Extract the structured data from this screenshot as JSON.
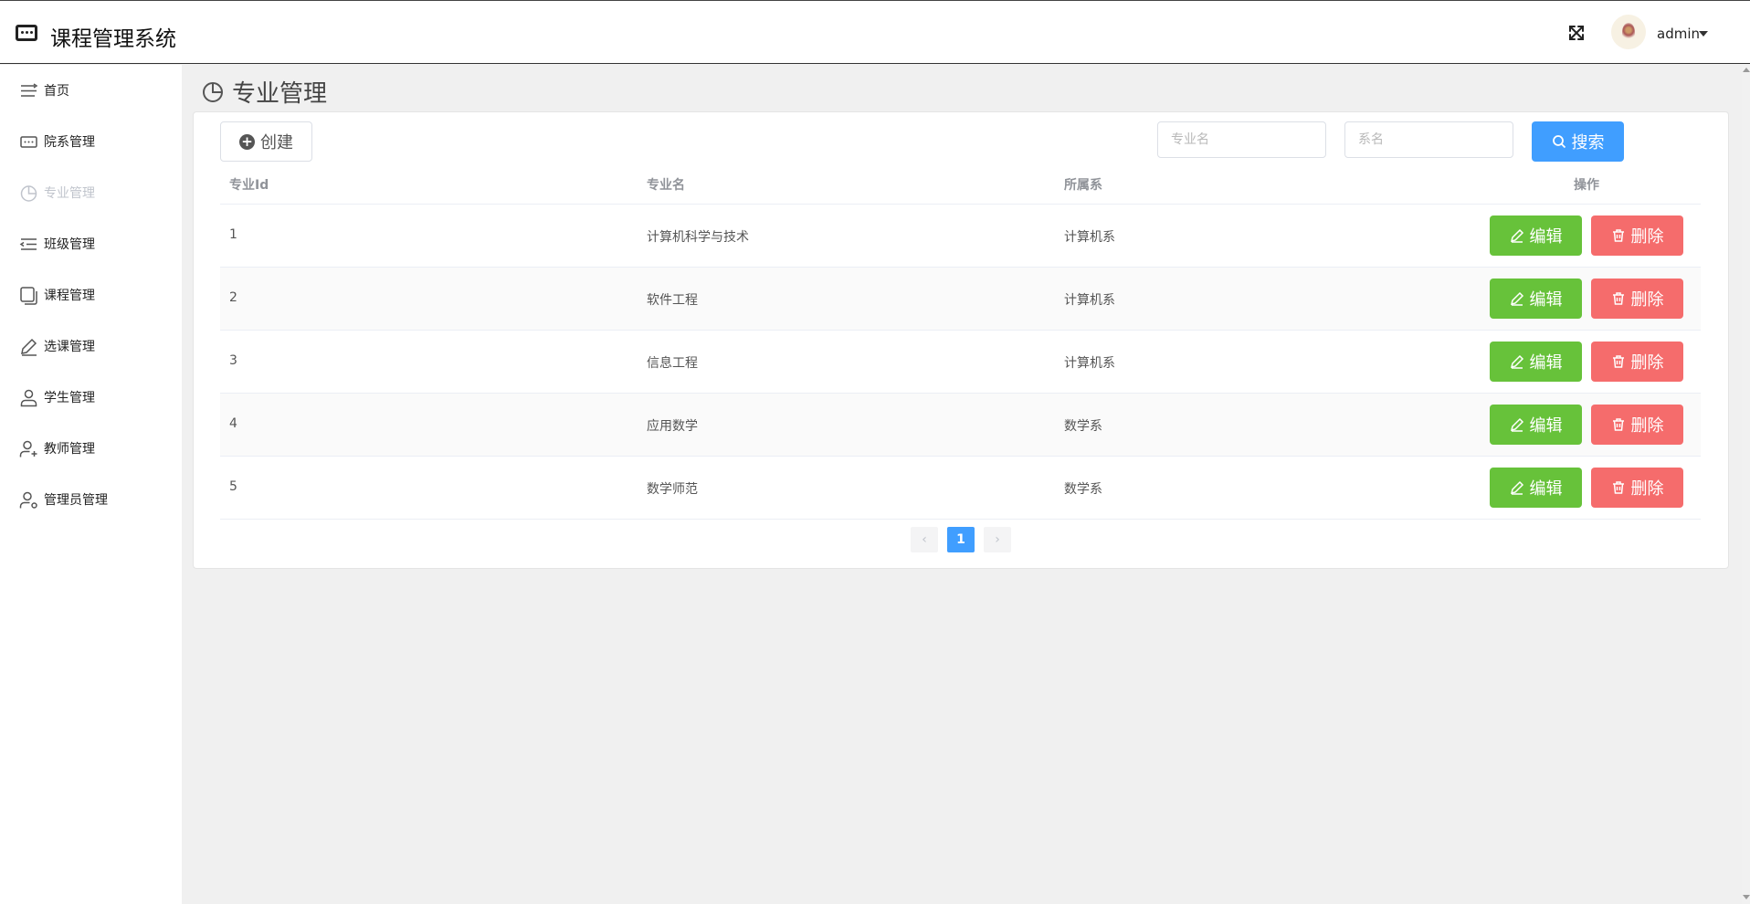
{
  "header": {
    "app_title": "课程管理系统",
    "user_name": "admin"
  },
  "sidebar": {
    "items": [
      {
        "label": "首页",
        "icon": "menu-lines-icon"
      },
      {
        "label": "院系管理",
        "icon": "dots-box-icon"
      },
      {
        "label": "专业管理",
        "icon": "pie-chart-icon"
      },
      {
        "label": "班级管理",
        "icon": "indent-list-icon"
      },
      {
        "label": "课程管理",
        "icon": "copy-icon"
      },
      {
        "label": "选课管理",
        "icon": "edit-pen-icon"
      },
      {
        "label": "学生管理",
        "icon": "user-icon"
      },
      {
        "label": "教师管理",
        "icon": "user-add-icon"
      },
      {
        "label": "管理员管理",
        "icon": "user-admin-icon"
      }
    ]
  },
  "main": {
    "page_title": "专业管理",
    "create_label": "创建",
    "major_name_placeholder": "专业名",
    "dept_name_placeholder": "系名",
    "search_label": "搜索"
  },
  "table": {
    "headers": [
      "专业Id",
      "专业名",
      "所属系",
      "操作"
    ],
    "rows": [
      {
        "id": "1",
        "name": "计算机科学与技术",
        "dept": "计算机系"
      },
      {
        "id": "2",
        "name": "软件工程",
        "dept": "计算机系"
      },
      {
        "id": "3",
        "name": "信息工程",
        "dept": "计算机系"
      },
      {
        "id": "4",
        "name": "应用数学",
        "dept": "数学系"
      },
      {
        "id": "5",
        "name": "数学师范",
        "dept": "数学系"
      }
    ],
    "edit_label": "编辑",
    "delete_label": "删除"
  },
  "pagination": {
    "prev": "‹",
    "current_page": "1",
    "next": "›"
  },
  "colors": {
    "primary": "#409eff",
    "success": "#67c23a",
    "danger": "#f56c6c"
  }
}
